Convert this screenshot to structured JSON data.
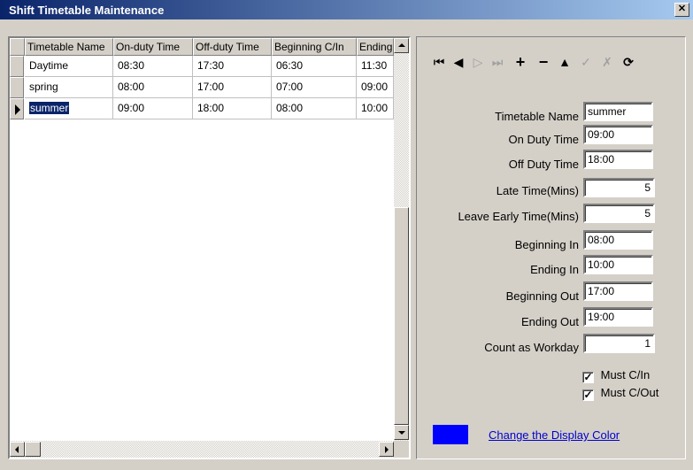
{
  "window": {
    "title": "Shift Timetable Maintenance",
    "close_glyph": "✕"
  },
  "grid": {
    "columns": [
      "Timetable Name",
      "On-duty Time",
      "Off-duty Time",
      "Beginning C/In",
      "Ending"
    ],
    "rows": [
      [
        "Daytime",
        "08:30",
        "17:30",
        "06:30",
        "11:30"
      ],
      [
        "spring",
        "08:00",
        "17:00",
        "07:00",
        "09:00"
      ],
      [
        "summer",
        "09:00",
        "18:00",
        "08:00",
        "10:00"
      ]
    ],
    "selected_row_index": 2
  },
  "navigator": {
    "buttons": [
      {
        "name": "first-record",
        "glyph": "⏮",
        "enabled": true
      },
      {
        "name": "prior-record",
        "glyph": "◀",
        "enabled": true
      },
      {
        "name": "next-record",
        "glyph": "▷",
        "enabled": false
      },
      {
        "name": "last-record",
        "glyph": "⏭",
        "enabled": false
      },
      {
        "name": "insert-record",
        "glyph": "+",
        "enabled": true
      },
      {
        "name": "delete-record",
        "glyph": "−",
        "enabled": true
      },
      {
        "name": "edit-record",
        "glyph": "▲",
        "enabled": true
      },
      {
        "name": "post-edit",
        "glyph": "✓",
        "enabled": false
      },
      {
        "name": "cancel-edit",
        "glyph": "✗",
        "enabled": false
      },
      {
        "name": "refresh-data",
        "glyph": "⟳",
        "enabled": true
      }
    ]
  },
  "form": {
    "timetable_name": {
      "label": "Timetable Name",
      "value": "summer"
    },
    "on_duty_time": {
      "label": "On Duty Time",
      "value": "09:00"
    },
    "off_duty_time": {
      "label": "Off Duty Time",
      "value": "18:00"
    },
    "late_time": {
      "label": "Late Time(Mins)",
      "value": "5"
    },
    "leave_early_time": {
      "label": "Leave Early Time(Mins)",
      "value": "5"
    },
    "beginning_in": {
      "label": "Beginning In",
      "value": "08:00"
    },
    "ending_in": {
      "label": "Ending In",
      "value": "10:00"
    },
    "beginning_out": {
      "label": "Beginning Out",
      "value": "17:00"
    },
    "ending_out": {
      "label": "Ending Out",
      "value": "19:00"
    },
    "count_as_workday": {
      "label": "Count as Workday",
      "value": "1"
    },
    "must_cin": {
      "label": "Must C/In",
      "checked": true
    },
    "must_cout": {
      "label": "Must C/Out",
      "checked": true
    },
    "check_glyph": "✓"
  },
  "display_color": {
    "color": "#0000ff",
    "link_label": "Change the Display Color"
  }
}
